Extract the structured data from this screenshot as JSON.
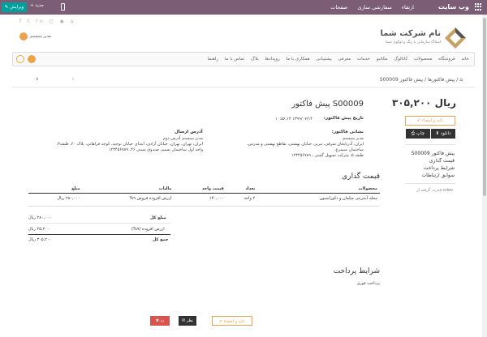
{
  "topbar": {
    "brand": "وب سایت",
    "menu": [
      "ارتقاء",
      "سفارشی سازی",
      "صفحات"
    ],
    "edit_label": "✎ ویرایش",
    "new_label": "+ جدید"
  },
  "header": {
    "logo_title": "نام شرکت شما",
    "logo_sub": "اسلاگ سازمانی با رنگ و لوگوی شما",
    "user_name": "مدیر سیستم"
  },
  "nav": {
    "items": [
      "خانه",
      "فروشگاه",
      "محصولات",
      "کاتالوگ",
      "مکاتبو",
      "خدمات",
      "معرفی",
      "پشتیبانی",
      "همکاری با ما",
      "رویدادها",
      "بلاگ",
      "تماس با ما",
      "راهنما"
    ]
  },
  "breadcrumb": {
    "home": "⌂",
    "root": "پیش فاکتورها",
    "current": "پیش فاکتور S00009"
  },
  "sidebar": {
    "price": "۳۰۵,۲۰۰ ریال",
    "sign_label": "✔ تائید و امضاء",
    "download_label": "دانلود",
    "print_label": "چاپ",
    "links": [
      "پیش فاکتور S00009",
      "قیمت گذاری",
      "شرایط پرداخت",
      "سوابق ارتباطات"
    ],
    "powered": "قدرت گرفته از odoo"
  },
  "document": {
    "title": "پیش فاکتور S00009",
    "date_label": "تاریخ پیش فاکتور:",
    "date_value": "۱۳۹۹/۰۷/۱۴ ۱۰:۵۶:۱۴",
    "address_label": "نشانی فاکتور:",
    "address_lines": [
      "مدیر سیستم",
      "ایران، آذربایجان شرقی، تبریز، خیابان بهشتی، تقاطع بهشتی و مدرس، ساختمان سیمرغ،",
      "طبقه ۵، شرکت تسهیل گستر ، ۱۲۳۴۵۶۷۸۹"
    ],
    "ship_label": "آدرس ارسال",
    "ship_lines": [
      "مدیر سیستم آدرس دوم",
      "ایران، تهران، تهران، خیابان آزادی، ابتدای خیابان توحید، کوچه فراهانی، پلاک ۲۰، طبقه۳،",
      "واحد اول ساختمان نسیم، صندوق پستی ۴۶، ۱۲۳۴۵۶۷۸۹"
    ]
  },
  "pricing": {
    "title": "قیمت گذاری",
    "headers": [
      "محصولات",
      "تعداد",
      "قیمت واحد",
      "مالیات",
      "مبلغ"
    ],
    "rows": [
      [
        "محله آبنترنتی مبلمان و دکوراسیون",
        "۲ واحد",
        "۱۴۰,۰۰۰",
        "ارزش افزوده فروش ۹%",
        "۲۸۰,۰۰۰ ریال"
      ]
    ],
    "subtotal_label": "مبلغ کل",
    "subtotal_value": "۲۸۰,۰۰۰ ریال",
    "tax_label": "ارزش افزوده (۹%)",
    "tax_value": "۲۵,۲۰۰ ریال",
    "total_label": "جمع کل",
    "total_value": "۳۰۵,۲۰۰ ریال"
  },
  "payment": {
    "title": "شرایط پرداخت",
    "text": "پرداخت فوری"
  },
  "footer_buttons": {
    "sign": "✔ تائید و امضاء",
    "comment": "نظر",
    "reject": "✖ رد"
  }
}
